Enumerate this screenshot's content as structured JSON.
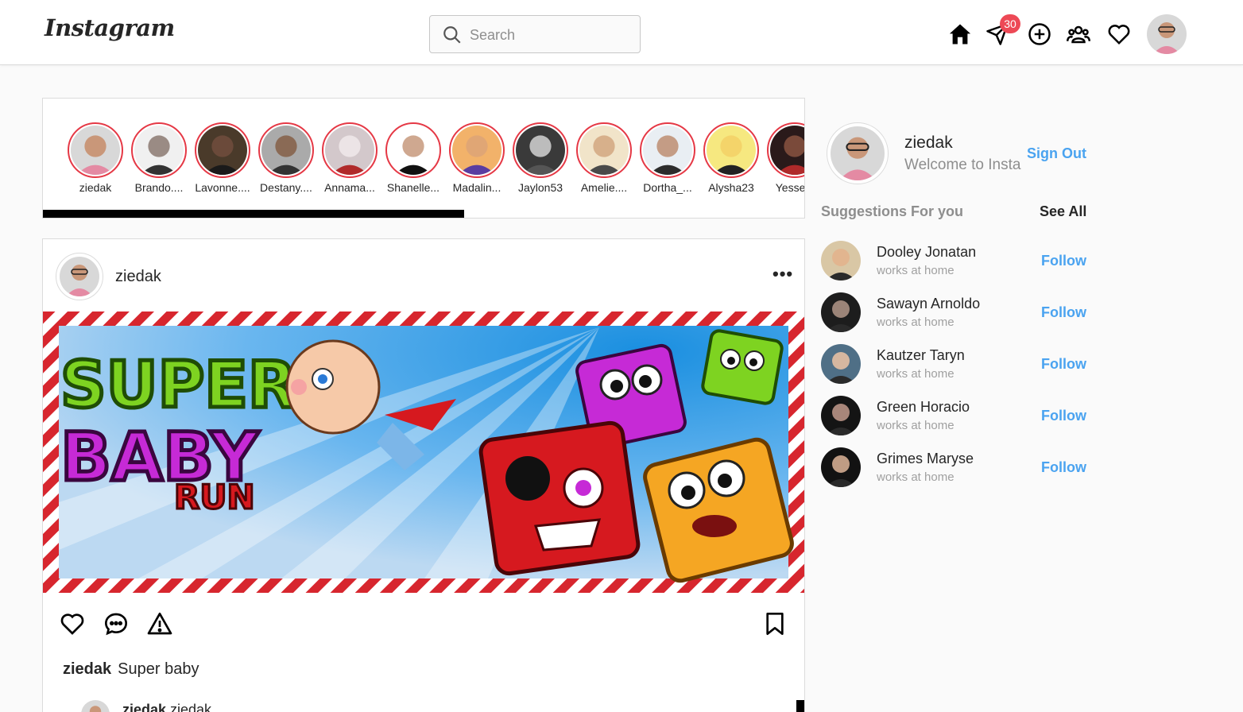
{
  "header": {
    "logo": "Instagram",
    "search_placeholder": "Search",
    "messages_badge": "30",
    "nav_icons": [
      "home-icon",
      "paper-plane-icon",
      "plus-circle-icon",
      "people-icon",
      "heart-icon"
    ]
  },
  "stories": [
    {
      "name": "ziedak",
      "face": "#c99779",
      "bg": "#d8d8d8",
      "shirt": "#e48aa3"
    },
    {
      "name": "Brando....",
      "face": "#9a8b84",
      "bg": "#f0f0f0",
      "shirt": "#333333"
    },
    {
      "name": "Lavonne....",
      "face": "#6b4a3a",
      "bg": "#4a3a2a",
      "shirt": "#1a1a1a"
    },
    {
      "name": "Destany....",
      "face": "#8a6a55",
      "bg": "#aaaaaa",
      "shirt": "#333333"
    },
    {
      "name": "Annama...",
      "face": "#ece4e6",
      "bg": "#d3c8cb",
      "shirt": "#b02a2a"
    },
    {
      "name": "Shanelle...",
      "face": "#cfa890",
      "bg": "#ffffff",
      "shirt": "#111111"
    },
    {
      "name": "Madalin...",
      "face": "#e0a675",
      "bg": "#f2b26a",
      "shirt": "#5a3da1"
    },
    {
      "name": "Jaylon53",
      "face": "#bcbcbc",
      "bg": "#3a3a3a",
      "shirt": "#555555"
    },
    {
      "name": "Amelie....",
      "face": "#d7b08b",
      "bg": "#f1e4c9",
      "shirt": "#4a4a4a"
    },
    {
      "name": "Dortha_...",
      "face": "#c49c85",
      "bg": "#e9eef3",
      "shirt": "#2c2c2c"
    },
    {
      "name": "Alysha23",
      "face": "#f4d46a",
      "bg": "#f6e880",
      "shirt": "#222222"
    },
    {
      "name": "Yesseni",
      "face": "#7a4a3a",
      "bg": "#2a1a1a",
      "shirt": "#b02a2a"
    }
  ],
  "post": {
    "username": "ziedak",
    "more_label": "•••",
    "image_title_1": "SUPER",
    "image_title_2": "BABY",
    "image_title_3": "RUN",
    "caption_user": "ziedak",
    "caption_text": "Super baby",
    "comment_user": "ziedak",
    "comment_text": "ziedak"
  },
  "sidebar": {
    "username": "ziedak",
    "welcome": "Welcome to Insta",
    "sign_out": "Sign Out",
    "suggestions_title": "Suggestions For you",
    "see_all": "See All",
    "suggestions": [
      {
        "name": "Dooley Jonatan",
        "sub": "works at home",
        "follow": "Follow",
        "face": "#e2b58f",
        "bg": "#d9c7a5"
      },
      {
        "name": "Sawayn Arnoldo",
        "sub": "works at home",
        "follow": "Follow",
        "face": "#9b8478",
        "bg": "#1d1d1d"
      },
      {
        "name": "Kautzer Taryn",
        "sub": "works at home",
        "follow": "Follow",
        "face": "#d6b7a0",
        "bg": "#4f6f86"
      },
      {
        "name": "Green Horacio",
        "sub": "works at home",
        "follow": "Follow",
        "face": "#a8867a",
        "bg": "#141414"
      },
      {
        "name": "Grimes Maryse",
        "sub": "works at home",
        "follow": "Follow",
        "face": "#bf9c84",
        "bg": "#121212"
      }
    ]
  },
  "colors": {
    "accent": "#4aa3f0",
    "badge": "#ed4956",
    "story_ring": "#e53845"
  }
}
